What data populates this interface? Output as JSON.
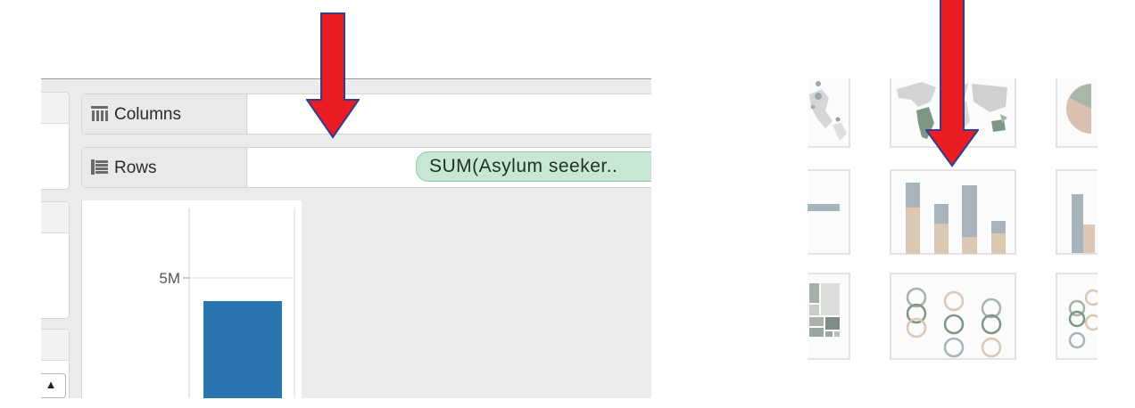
{
  "shelves": {
    "columns_label": "Columns",
    "rows_label": "Rows",
    "rows_pill": "SUM(Asylum seeker.."
  },
  "view": {
    "y_tick": "5M",
    "bar_value_fraction_of_tick": 0.83
  },
  "icons": {
    "columns_icon": "columns-grid-icon",
    "rows_icon": "rows-list-icon",
    "scroll_up": "▲",
    "annotation_arrow": "red-down-arrow"
  },
  "showme": {
    "thumbnails": [
      "symbol-map",
      "filled-map",
      "pie-chart",
      "horizontal-bars",
      "stacked-bars",
      "side-by-side-bars",
      "treemap",
      "circle-views",
      "side-by-side-circles"
    ],
    "selected": "stacked-bars"
  },
  "colors": {
    "annotation_red": "#ec1c24",
    "bar_blue": "#2a75b0",
    "pill_green": "#c8e6d4",
    "thumb_grey": "#a7b4bb",
    "thumb_tan": "#dcc7b5",
    "thumb_green": "#7f9684"
  }
}
